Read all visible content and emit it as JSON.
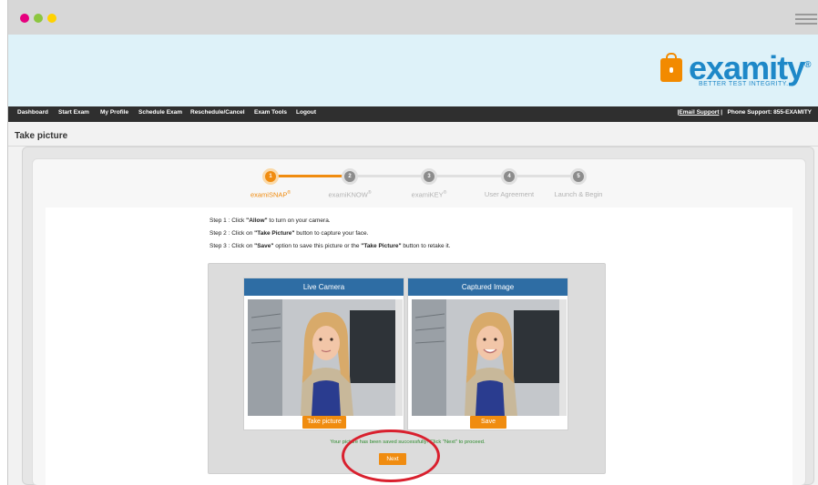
{
  "chrome": {
    "dots": [
      "red",
      "green",
      "yellow"
    ],
    "menu_icon": "hamburger-icon"
  },
  "brand": {
    "name": "examity",
    "registered": "®",
    "tagline": "BETTER TEST INTEGRITY.",
    "icon": "lock-icon",
    "color": "#1e88c8",
    "accent": "#f28a00"
  },
  "nav": {
    "items": [
      {
        "label": "Dashboard"
      },
      {
        "label": "Start Exam"
      },
      {
        "label": "My Profile"
      },
      {
        "label": "Schedule Exam"
      },
      {
        "label": "Reschedule/Cancel"
      },
      {
        "label": "Exam Tools"
      },
      {
        "label": "Logout"
      }
    ],
    "email_support": "Email Support",
    "separator": "|",
    "phone_support": "Phone Support: 855-EXAMITY"
  },
  "page": {
    "title": "Take picture"
  },
  "steps": [
    {
      "number": "1",
      "name": "examiSNAP",
      "mark": "®",
      "active": true
    },
    {
      "number": "2",
      "name": "examiKNOW",
      "mark": "®",
      "active": false
    },
    {
      "number": "3",
      "name": "examiKEY",
      "mark": "®",
      "active": false
    },
    {
      "number": "4",
      "name": "User Agreement",
      "mark": "",
      "active": false
    },
    {
      "number": "5",
      "name": "Launch & Begin",
      "mark": "",
      "active": false
    }
  ],
  "instructions": {
    "step1": {
      "prefix": "Step 1 : Click ",
      "bold": "\"Allow\"",
      "suffix": " to turn on your camera."
    },
    "step2": {
      "prefix": "Step 2 : Click on ",
      "bold": "\"Take Picture\"",
      "suffix": " button to capture your face."
    },
    "step3": {
      "prefix": "Step 3 : Click on ",
      "bold": "\"Save\"",
      "middle": " option to save this picture or the ",
      "bold2": "\"Take Picture\"",
      "suffix": " button to retake it."
    }
  },
  "camera": {
    "live_title": "Live Camera",
    "captured_title": "Captured Image",
    "take_picture": "Take picture",
    "save": "Save"
  },
  "status": {
    "message": "Your picture has been saved successfully! Click \"Next\" to proceed.",
    "next": "Next"
  },
  "colors": {
    "primary_orange": "#f08c10",
    "panel_blue": "#2e6da4",
    "success_green": "#2e8b2e",
    "highlight_red": "#d9202e",
    "navbar": "#2f2f2f",
    "header_bg": "#def2f9"
  }
}
